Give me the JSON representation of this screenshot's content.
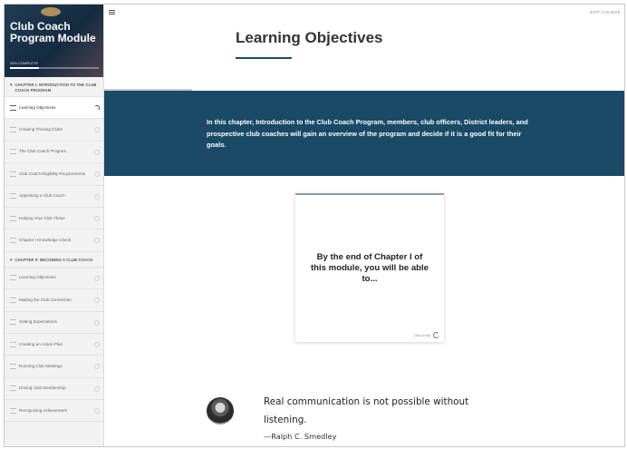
{
  "sidebar": {
    "course_title": "Club Coach Program Module",
    "progress_text": "33% COMPLETE",
    "progress_fraction": 0.33,
    "chapters": [
      {
        "title": "CHAPTER I: INTRODUCTION TO THE CLUB COACH PROGRAM",
        "lessons": [
          "Learning Objectives",
          "Creating Thriving Clubs",
          "The Club Coach Program",
          "Club Coach Eligibility Requirements",
          "Appointing a Club Coach",
          "Helping Your Club Thrive",
          "Chapter I Knowledge Check"
        ]
      },
      {
        "title": "CHAPTER II: BECOMING A CLUB COACH",
        "lessons": [
          "Learning Objectives",
          "Making the Club Connection",
          "Setting Expectations",
          "Creating an Action Plan",
          "Running Club Meetings",
          "Driving Club Membership",
          "Recognizing Achievement"
        ]
      }
    ]
  },
  "header": {
    "exit_label": "EXIT COURSE"
  },
  "main": {
    "title": "Learning Objectives",
    "lesson_progress_fraction": 0.41,
    "banner_text": "In this chapter, Introduction to the Club Coach Program, members, club officers, District leaders, and prospective club coaches will gain an overview of the program and decide if it is a good fit for their goals.",
    "flashcard": {
      "text": "By the end of Chapter I of this module, you will be able to...",
      "flip_label": "Click to flip"
    },
    "quote": {
      "text": "Real communication is not possible without listening.",
      "author": "—Ralph C. Smedley"
    }
  },
  "colors": {
    "accent": "#1a4a66",
    "sidebar_bg": "#f2f2f2"
  }
}
